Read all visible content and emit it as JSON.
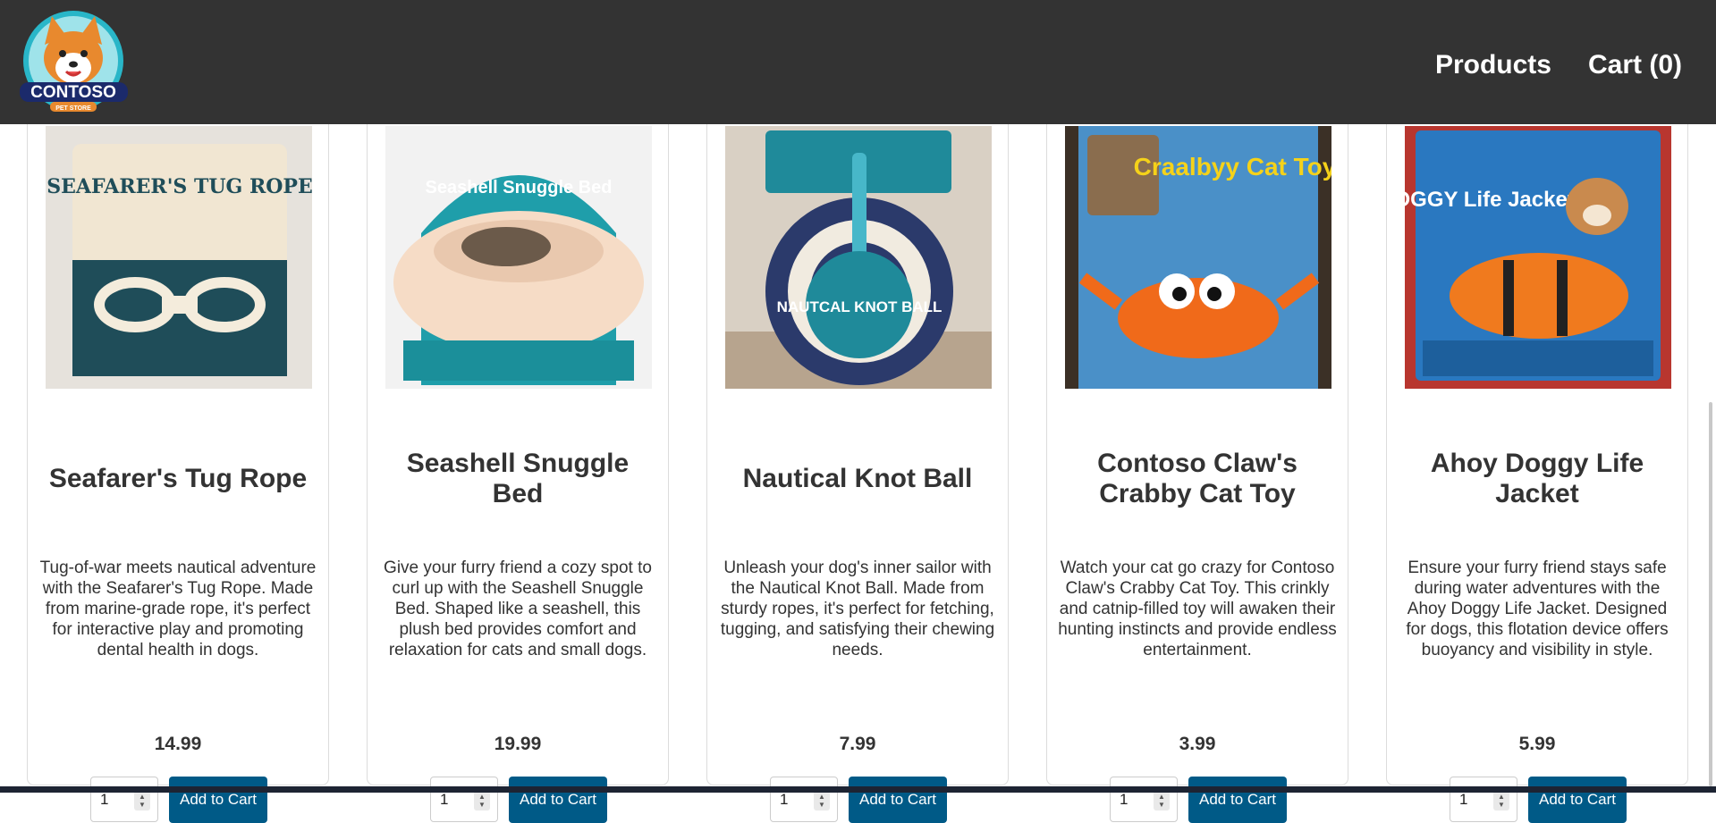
{
  "header": {
    "logo_main": "CONTOSO",
    "logo_sub": "PET STORE",
    "nav": [
      {
        "label": "Products"
      },
      {
        "label": "Cart (0)"
      }
    ]
  },
  "colors": {
    "header_bg": "#333333",
    "button_bg": "#005a87",
    "footer_strip": "#1d2433"
  },
  "products": [
    {
      "name": "Seafarer's Tug Rope",
      "description": "Tug-of-war meets nautical adventure with the Seafarer's Tug Rope. Made from marine-grade rope, it's perfect for interactive play and promoting dental health in dogs.",
      "price": "14.99",
      "quantity": "1",
      "add_label": "Add to Cart",
      "packaging_text": "SEAFARER'S TUG ROPE"
    },
    {
      "name": "Seashell Snuggle Bed",
      "description": "Give your furry friend a cozy spot to curl up with the Seashell Snuggle Bed. Shaped like a seashell, this plush bed provides comfort and relaxation for cats and small dogs.",
      "price": "19.99",
      "quantity": "1",
      "add_label": "Add to Cart",
      "packaging_text": "Seashell Snuggle Bed"
    },
    {
      "name": "Nautical Knot Ball",
      "description": "Unleash your dog's inner sailor with the Nautical Knot Ball. Made from sturdy ropes, it's perfect for fetching, tugging, and satisfying their chewing needs.",
      "price": "7.99",
      "quantity": "1",
      "add_label": "Add to Cart",
      "packaging_text": "NAUTCAL KNOT BALL"
    },
    {
      "name": "Contoso Claw's Crabby Cat Toy",
      "description": "Watch your cat go crazy for Contoso Claw's Crabby Cat Toy. This crinkly and catnip-filled toy will awaken their hunting instincts and provide endless entertainment.",
      "price": "3.99",
      "quantity": "1",
      "add_label": "Add to Cart",
      "packaging_text": "Craalbyy Cat Toy"
    },
    {
      "name": "Ahoy Doggy Life Jacket",
      "description": "Ensure your furry friend stays safe during water adventures with the Ahoy Doggy Life Jacket. Designed for dogs, this flotation device offers buoyancy and visibility in style.",
      "price": "5.99",
      "quantity": "1",
      "add_label": "Add to Cart",
      "packaging_text": "DOGGY Life Jacket"
    }
  ]
}
